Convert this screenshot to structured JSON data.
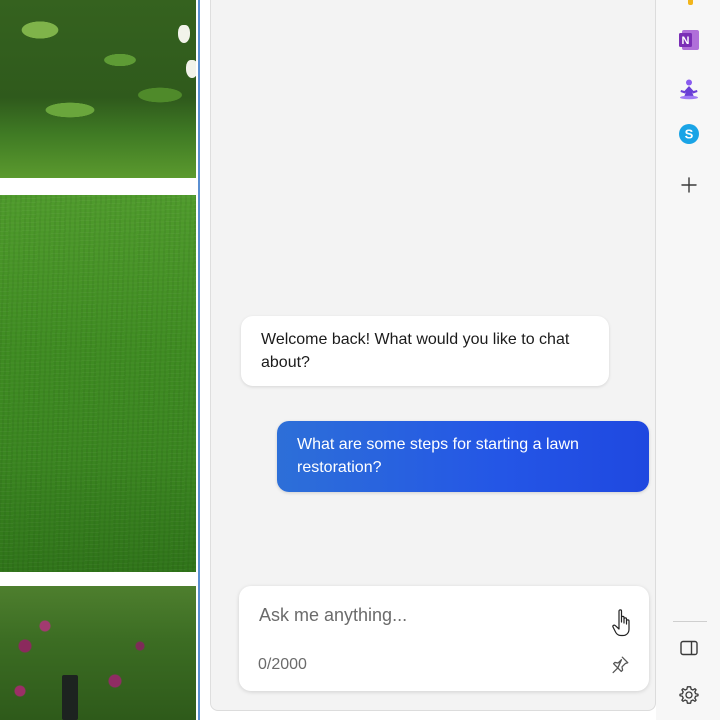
{
  "chat": {
    "messages": [
      {
        "role": "assistant",
        "text": "Welcome back! What would you like to chat about?"
      },
      {
        "role": "user",
        "text": "What are some steps for starting a lawn restoration?"
      }
    ],
    "input": {
      "placeholder": "Ask me anything...",
      "value": "",
      "char_count": "0/2000"
    }
  },
  "rail": {
    "apps": [
      {
        "icon": "onenote-icon",
        "letter": "N"
      },
      {
        "icon": "meditation-icon"
      },
      {
        "icon": "skype-icon",
        "letter": "S"
      },
      {
        "icon": "add-icon"
      }
    ]
  },
  "colors": {
    "user_bubble": "#2456e6",
    "pane_background": "#f3f3f3",
    "onenote": "#7b2fb6",
    "skype": "#1aa4e6",
    "meditation": "#7a4fe0"
  }
}
